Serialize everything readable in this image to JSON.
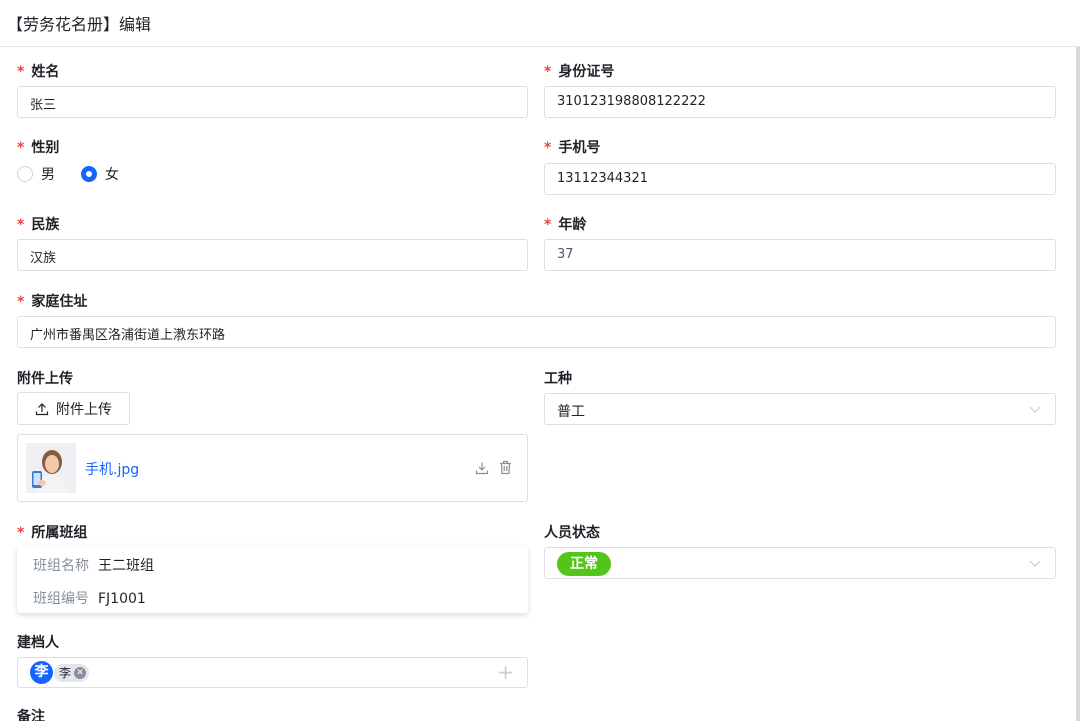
{
  "header": {
    "title": "【劳务花名册】编辑"
  },
  "form": {
    "name": {
      "label": "姓名",
      "value": "张三"
    },
    "id_number": {
      "label": "身份证号",
      "value": "310123198808122222"
    },
    "gender": {
      "label": "性别",
      "options": [
        "男",
        "女"
      ],
      "selected": "女"
    },
    "phone": {
      "label": "手机号",
      "value": "13112344321"
    },
    "ethnicity": {
      "label": "民族",
      "value": "汉族"
    },
    "age": {
      "label": "年龄",
      "value": "37"
    },
    "address": {
      "label": "家庭住址",
      "value": "广州市番禺区洛浦街道上漖东环路"
    },
    "attachment": {
      "label": "附件上传",
      "button_label": "附件上传",
      "file_name": "手机.jpg"
    },
    "job_type": {
      "label": "工种",
      "value": "普工"
    },
    "team": {
      "label": "所属班组",
      "name_key": "班组名称",
      "name_value": "王二班组",
      "code_key": "班组编号",
      "code_value": "FJ1001"
    },
    "status": {
      "label": "人员状态",
      "value": "正常"
    },
    "creator": {
      "label": "建档人",
      "avatar_text": "李",
      "tag_text": "李"
    },
    "remark": {
      "label": "备注"
    }
  },
  "required_mark": "*",
  "colors": {
    "accent": "#1664ff",
    "required": "#f53f3f",
    "status_ok": "#52c41a"
  },
  "icons": [
    "upload-icon",
    "download-icon",
    "trash-icon",
    "chevron-down-icon",
    "remove-tag-icon",
    "plus-icon"
  ]
}
